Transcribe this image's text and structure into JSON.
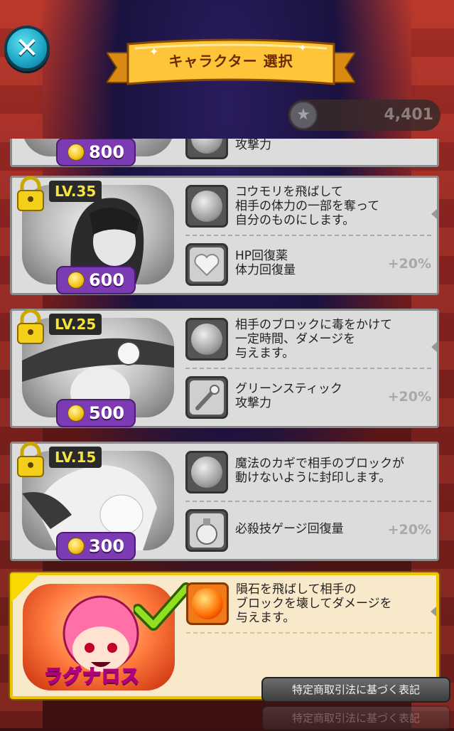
{
  "header": {
    "close_label": "✕",
    "title": "キャラクター 選択",
    "star_count": "4,401"
  },
  "cards": [
    {
      "price": "800",
      "skills": [
        {
          "text": "攻撃力",
          "bonus": ""
        }
      ]
    },
    {
      "level": "LV.35",
      "price": "600",
      "locked": true,
      "skills": [
        {
          "text": "コウモリを飛ばして\n相手の体力の一部を奪って\n自分のものにします。",
          "bonus": ""
        },
        {
          "text": "HP回復薬\n体力回復量",
          "bonus": "+20%"
        }
      ]
    },
    {
      "level": "LV.25",
      "price": "500",
      "locked": true,
      "skills": [
        {
          "text": "相手のブロックに毒をかけて\n一定時間、ダメージを\n与えます。",
          "bonus": ""
        },
        {
          "text": "グリーンスティック\n攻撃力",
          "bonus": "+20%"
        }
      ]
    },
    {
      "level": "LV.15",
      "price": "300",
      "locked": true,
      "skills": [
        {
          "text": "魔法のカギで相手のブロックが\n動けないように封印します。",
          "bonus": ""
        },
        {
          "text": "必殺技ゲージ回復量",
          "bonus": "+20%"
        }
      ]
    },
    {
      "name": "ラグナロス",
      "selected": true,
      "skills": [
        {
          "text": "隕石を飛ばして相手の\nブロックを壊してダメージを\n与えます。",
          "bonus": ""
        }
      ]
    }
  ],
  "footer": {
    "legal_label": "特定商取引法に基づく表記"
  },
  "colors": {
    "accent": "#f3c300",
    "price_badge": "#7d3bb3",
    "level_text": "#f5e43c"
  }
}
